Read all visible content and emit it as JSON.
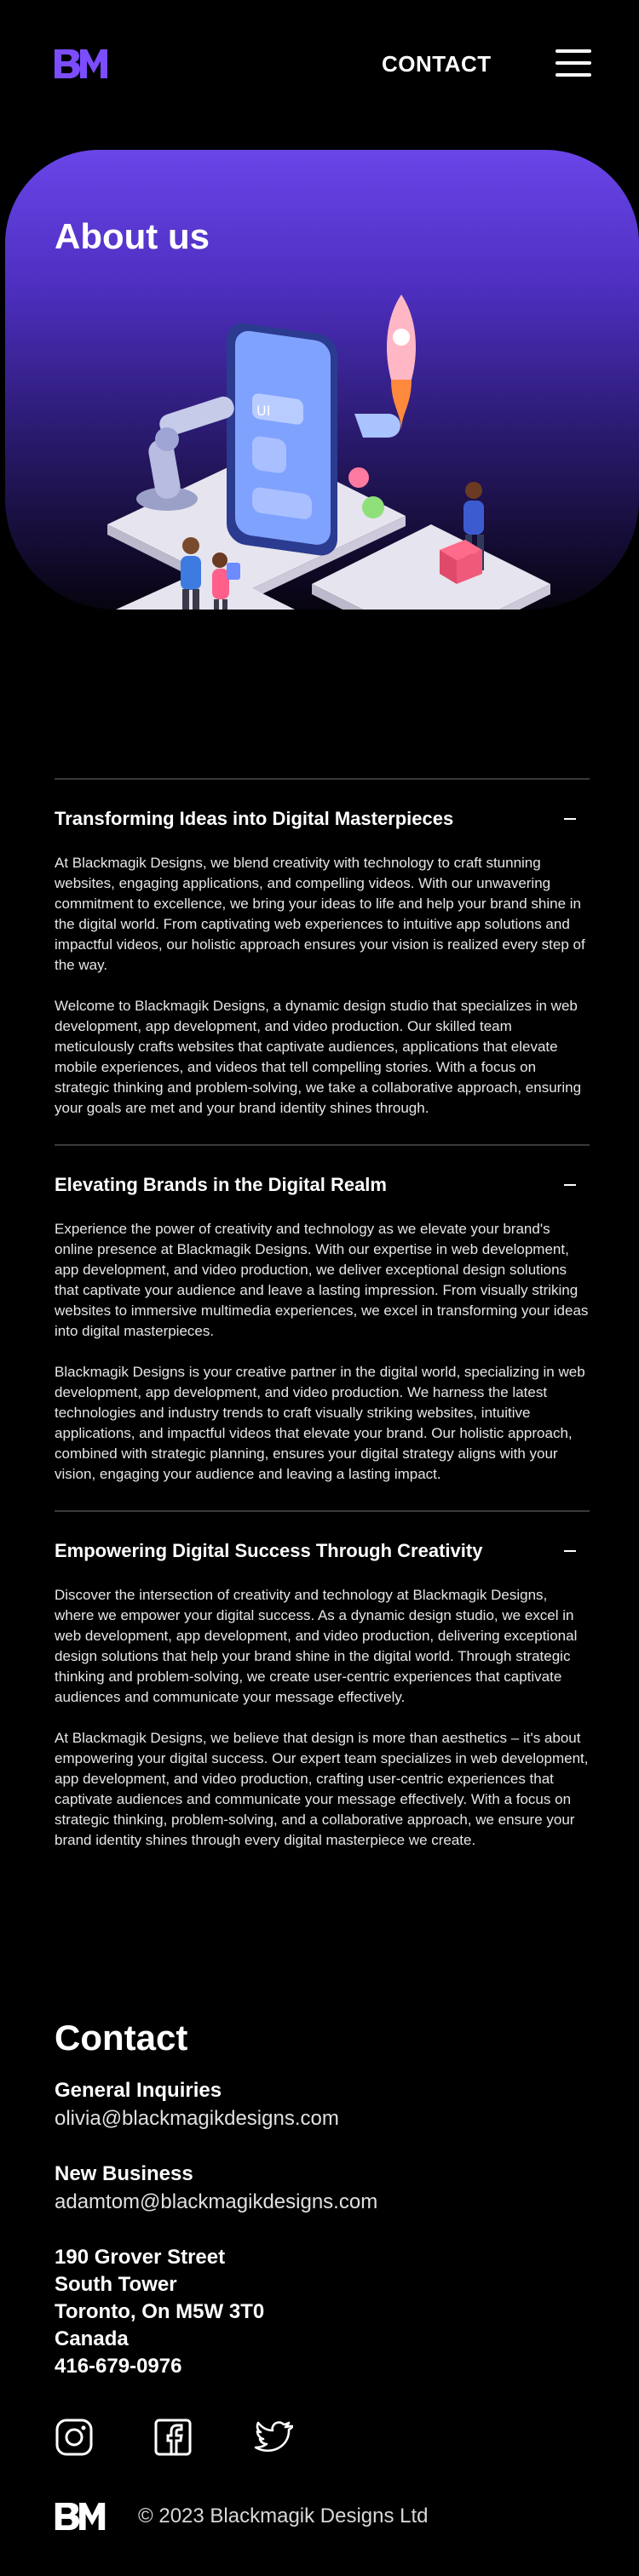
{
  "header": {
    "contact_label": "CONTACT"
  },
  "hero": {
    "title": "About us"
  },
  "accordion": [
    {
      "title": "Transforming Ideas into Digital Masterpieces",
      "paragraphs": [
        "At Blackmagik Designs, we blend creativity with technology to craft stunning websites, engaging applications, and compelling videos. With our unwavering commitment to excellence, we bring your ideas to life and help your brand shine in the digital world. From captivating web experiences to intuitive app solutions and impactful videos, our holistic approach ensures your vision is realized every step of the way.",
        "Welcome to Blackmagik Designs, a dynamic design studio that specializes in web development, app development, and video production. Our skilled team meticulously crafts websites that captivate audiences, applications that elevate mobile experiences, and videos that tell compelling stories. With a focus on strategic thinking and problem-solving, we take a collaborative approach, ensuring your goals are met and your brand identity shines through."
      ]
    },
    {
      "title": "Elevating Brands in the Digital Realm",
      "paragraphs": [
        "Experience the power of creativity and technology as we elevate your brand's online presence at Blackmagik Designs. With our expertise in web development, app development, and video production, we deliver exceptional design solutions that captivate your audience and leave a lasting impression. From visually striking websites to immersive multimedia experiences, we excel in transforming your ideas into digital masterpieces.",
        "Blackmagik Designs is your creative partner in the digital world, specializing in web development, app development, and video production. We harness the latest technologies and industry trends to craft visually striking websites, intuitive applications, and impactful videos that elevate your brand. Our holistic approach, combined with strategic planning, ensures your digital strategy aligns with your vision, engaging your audience and leaving a lasting impact."
      ]
    },
    {
      "title": "Empowering Digital Success Through Creativity",
      "paragraphs": [
        "Discover the intersection of creativity and technology at Blackmagik Designs, where we empower your digital success. As a dynamic design studio, we excel in web development, app development, and video production, delivering exceptional design solutions that help your brand shine in the digital world. Through strategic thinking and problem-solving, we create user-centric experiences that captivate audiences and communicate your message effectively.",
        "At Blackmagik Designs, we believe that design is more than aesthetics – it's about empowering your digital success. Our expert team specializes in web development, app development, and video production, crafting user-centric experiences that captivate audiences and communicate your message effectively. With a focus on strategic thinking, problem-solving, and a collaborative approach, we ensure your brand identity shines through every digital masterpiece we create."
      ]
    }
  ],
  "contact": {
    "title": "Contact",
    "general_label": "General Inquiries",
    "general_email": "olivia@blackmagikdesigns.com",
    "business_label": "New Business",
    "business_email": "adamtom@blackmagikdesigns.com",
    "address": [
      "190 Grover Street",
      "South Tower",
      "Toronto, On M5W 3T0",
      "Canada",
      "416-679-0976"
    ]
  },
  "social": {
    "icons": [
      "instagram-icon",
      "facebook-icon",
      "twitter-icon"
    ]
  },
  "footer": {
    "copyright": "© 2023 Blackmagik Designs Ltd"
  },
  "colors": {
    "accent": "#6a45e8",
    "background": "#000000",
    "logo": "#7b4dff"
  }
}
